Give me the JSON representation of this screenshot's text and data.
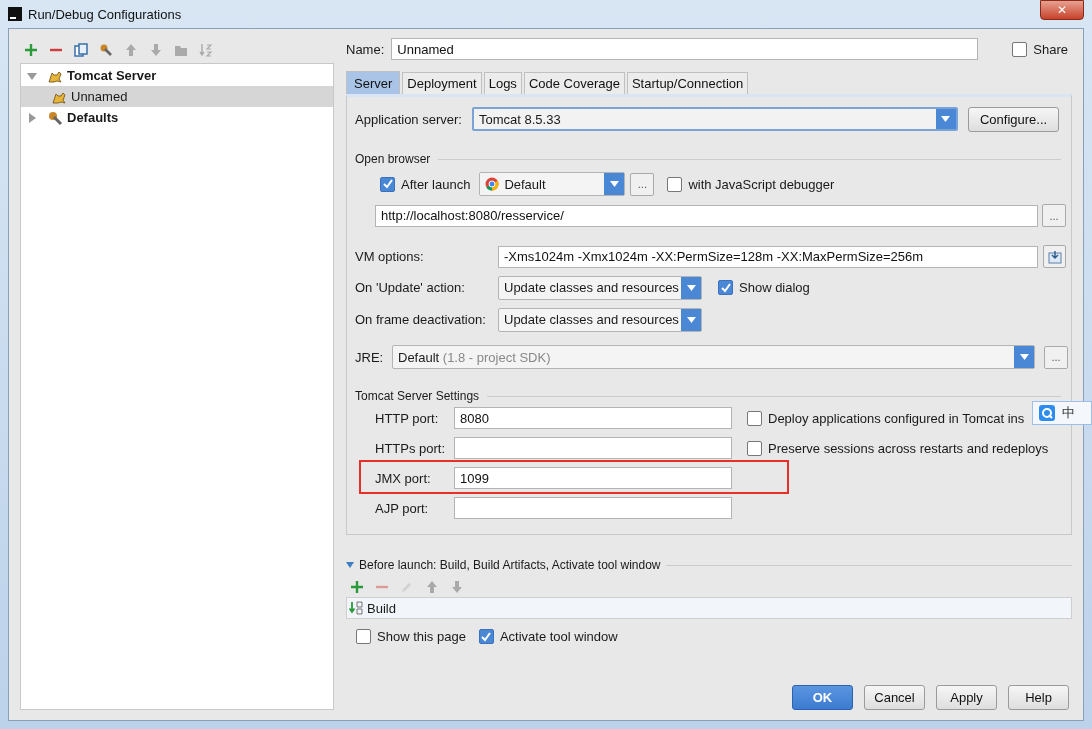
{
  "window": {
    "title": "Run/Debug Configurations",
    "close": "✕"
  },
  "toolbar": [
    {
      "kind": "add",
      "disabled": false
    },
    {
      "kind": "remove",
      "disabled": false
    },
    {
      "kind": "copy",
      "disabled": false
    },
    {
      "kind": "edit",
      "disabled": false
    },
    {
      "kind": "up",
      "disabled": true
    },
    {
      "kind": "down",
      "disabled": true
    },
    {
      "kind": "folder",
      "disabled": true
    },
    {
      "kind": "sort",
      "disabled": true
    }
  ],
  "tree": [
    {
      "label": "Tomcat Server",
      "kind": "tomcat",
      "expanded": true,
      "selected": false,
      "children": [
        {
          "label": "Unnamed",
          "kind": "tomcat",
          "selected": true
        }
      ]
    },
    {
      "label": "Defaults",
      "kind": "defaults",
      "expanded": false,
      "selected": false
    }
  ],
  "name_field": {
    "label": "Name:",
    "value": "Unnamed"
  },
  "share": {
    "label": "Share",
    "checked": false
  },
  "tabs": [
    {
      "label": "Server",
      "selected": true
    },
    {
      "label": "Deployment",
      "selected": false
    },
    {
      "label": "Logs",
      "selected": false
    },
    {
      "label": "Code Coverage",
      "selected": false
    },
    {
      "label": "Startup/Connection",
      "selected": false
    }
  ],
  "server": {
    "app_server": {
      "label": "Application server:",
      "value": "Tomcat 8.5.33",
      "button": "Configure..."
    },
    "open_browser": {
      "title": "Open browser",
      "after_launch": {
        "label": "After launch",
        "checked": true
      },
      "browser": "Default",
      "more": "...",
      "js_debugger": {
        "label": "with JavaScript debugger",
        "checked": false
      },
      "url": "http://localhost:8080/resservice/",
      "url_more": "..."
    },
    "vm_options": {
      "label": "VM options:",
      "value": "-Xms1024m -Xmx1024m -XX:PermSize=128m -XX:MaxPermSize=256m"
    },
    "on_update": {
      "label": "On 'Update' action:",
      "value": "Update classes and resources"
    },
    "show_dialog": {
      "label": "Show dialog",
      "checked": true
    },
    "on_frame": {
      "label": "On frame deactivation:",
      "value": "Update classes and resources"
    },
    "jre": {
      "label": "JRE:",
      "value": "Default",
      "hint": "(1.8 - project SDK)",
      "more": "..."
    },
    "tomcat_settings": {
      "title": "Tomcat Server Settings",
      "ports": [
        {
          "label": "HTTP port:",
          "value": "8080",
          "highlighted": false
        },
        {
          "label": "HTTPs port:",
          "highlighted": false
        },
        {
          "label": "JMX port:",
          "value": "1099",
          "highlighted": true
        },
        {
          "label": "AJP port:",
          "highlighted": false
        }
      ],
      "options": [
        {
          "label": "Deploy applications configured in Tomcat ins",
          "checked": false
        },
        {
          "label": "Preserve sessions across restarts and redeploys",
          "checked": false
        }
      ]
    }
  },
  "before_launch": {
    "title": "Before launch: Build, Build Artifacts, Activate tool window",
    "expanded": true,
    "tools": [
      {
        "kind": "add",
        "disabled": false
      },
      {
        "kind": "remove",
        "disabled": true
      },
      {
        "kind": "edit",
        "disabled": true
      },
      {
        "kind": "up",
        "disabled": true
      },
      {
        "kind": "down",
        "disabled": true
      }
    ],
    "tasks": [
      {
        "label": "Build"
      }
    ]
  },
  "show_this_page": {
    "label": "Show this page",
    "checked": false
  },
  "activate_tool_window": {
    "label": "Activate tool window",
    "checked": true
  },
  "buttons": [
    {
      "label": "OK",
      "kind": "primary"
    },
    {
      "label": "Cancel",
      "kind": "normal"
    },
    {
      "label": "Apply",
      "kind": "normal"
    },
    {
      "label": "Help",
      "kind": "normal"
    }
  ],
  "ime": {
    "label": "中"
  }
}
